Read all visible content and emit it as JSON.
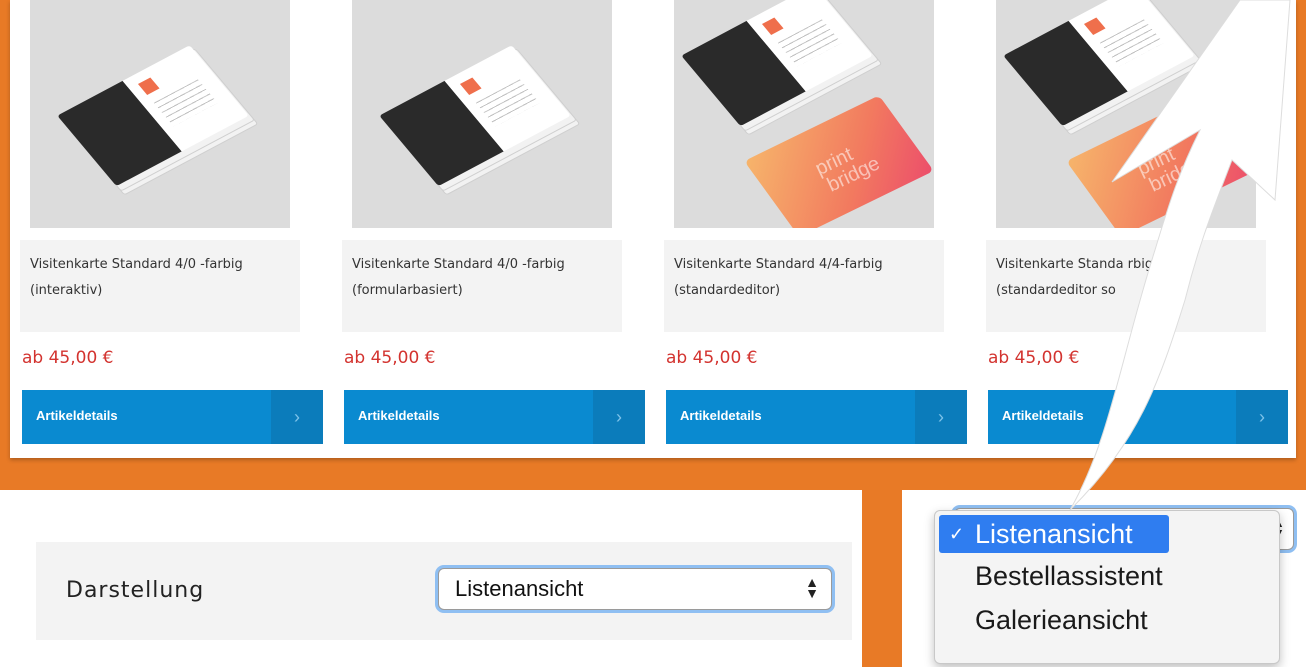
{
  "products": [
    {
      "title": "Visitenkarte Standard 4/0 -farbig (interaktiv)",
      "price": "ab 45,00 €",
      "button": "Artikeldetails",
      "has_orange_card": false
    },
    {
      "title": "Visitenkarte Standard 4/0 -farbig (formularbasiert)",
      "price": "ab 45,00 €",
      "button": "Artikeldetails",
      "has_orange_card": false
    },
    {
      "title": "Visitenkarte Standard 4/4-farbig (standardeditor)",
      "price": "ab 45,00 €",
      "button": "Artikeldetails",
      "has_orange_card": true
    },
    {
      "title": "Visitenkarte Standa         rbig (standardeditor so",
      "price": "ab 45,00 €",
      "button": "Artikeldetails",
      "has_orange_card": true
    }
  ],
  "display_setting": {
    "label": "Darstellung",
    "selected": "Listenansicht"
  },
  "dropdown": {
    "options": [
      "Listenansicht",
      "Bestellassistent",
      "Galerieansicht"
    ],
    "selected_index": 0,
    "check": "✓"
  },
  "card_mockup_text": {
    "logo": "print bridge",
    "orange_card": "print bridge"
  },
  "colors": {
    "background_orange": "#e87a26",
    "button_blue": "#0a8ad0",
    "price_red": "#d3332f",
    "dropdown_highlight": "#2f7df0"
  }
}
